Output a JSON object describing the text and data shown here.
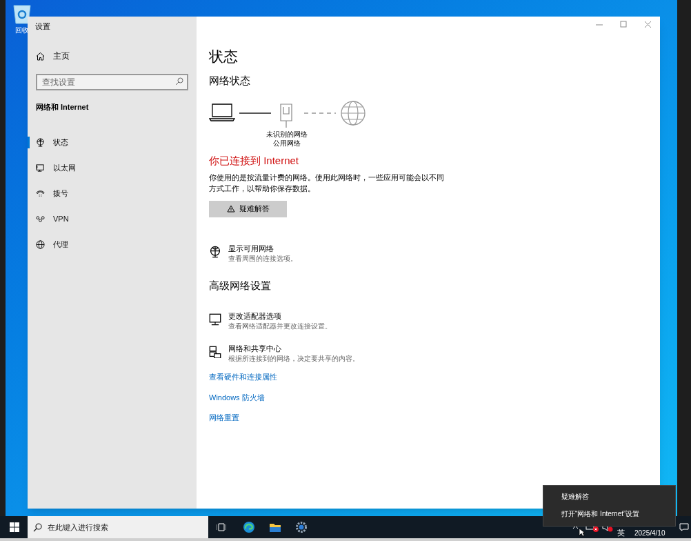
{
  "desktop": {
    "icon_label": "回收"
  },
  "window": {
    "title": "设置"
  },
  "sidebar": {
    "home": "主页",
    "search": {
      "placeholder": "查找设置"
    },
    "section": "网络和 Internet",
    "items": [
      {
        "label": "状态",
        "kind": "globe-monitor",
        "selected": true
      },
      {
        "label": "以太网",
        "kind": "ethernet",
        "selected": false
      },
      {
        "label": "拨号",
        "kind": "phone",
        "selected": false
      },
      {
        "label": "VPN",
        "kind": "vpn",
        "selected": false
      },
      {
        "label": "代理",
        "kind": "globe",
        "selected": false
      }
    ]
  },
  "content": {
    "title": "状态",
    "network_status": "网络状态",
    "network_labels": [
      "未识别的网络",
      "公用网络"
    ],
    "status_message": "你已连接到 Internet",
    "description": "你使用的是按流量计费的网络。使用此网络时，一些应用可能会以不同方式工作，以帮助你保存数据。",
    "troubleshoot_button": "疑难解答",
    "show_networks": {
      "title": "显示可用网络",
      "subtitle": "查看周围的连接选项。",
      "kind": "globe-monitor"
    },
    "advanced_heading": "高级网络设置",
    "advanced_items": [
      {
        "title": "更改适配器选项",
        "subtitle": "查看网络适配器并更改连接设置。",
        "kind": "monitor"
      },
      {
        "title": "网络和共享中心",
        "subtitle": "根据所连接到的网络，决定要共享的内容。",
        "kind": "sharing"
      }
    ],
    "links": [
      "查看硬件和连接属性",
      "Windows 防火墙",
      "网络重置"
    ]
  },
  "taskbar": {
    "search": {
      "placeholder": "在此键入进行搜索"
    },
    "ime": "英",
    "date": "2025/4/10"
  },
  "context_menu": {
    "items": [
      "疑难解答",
      "打开“网络和 Internet”设置"
    ]
  }
}
